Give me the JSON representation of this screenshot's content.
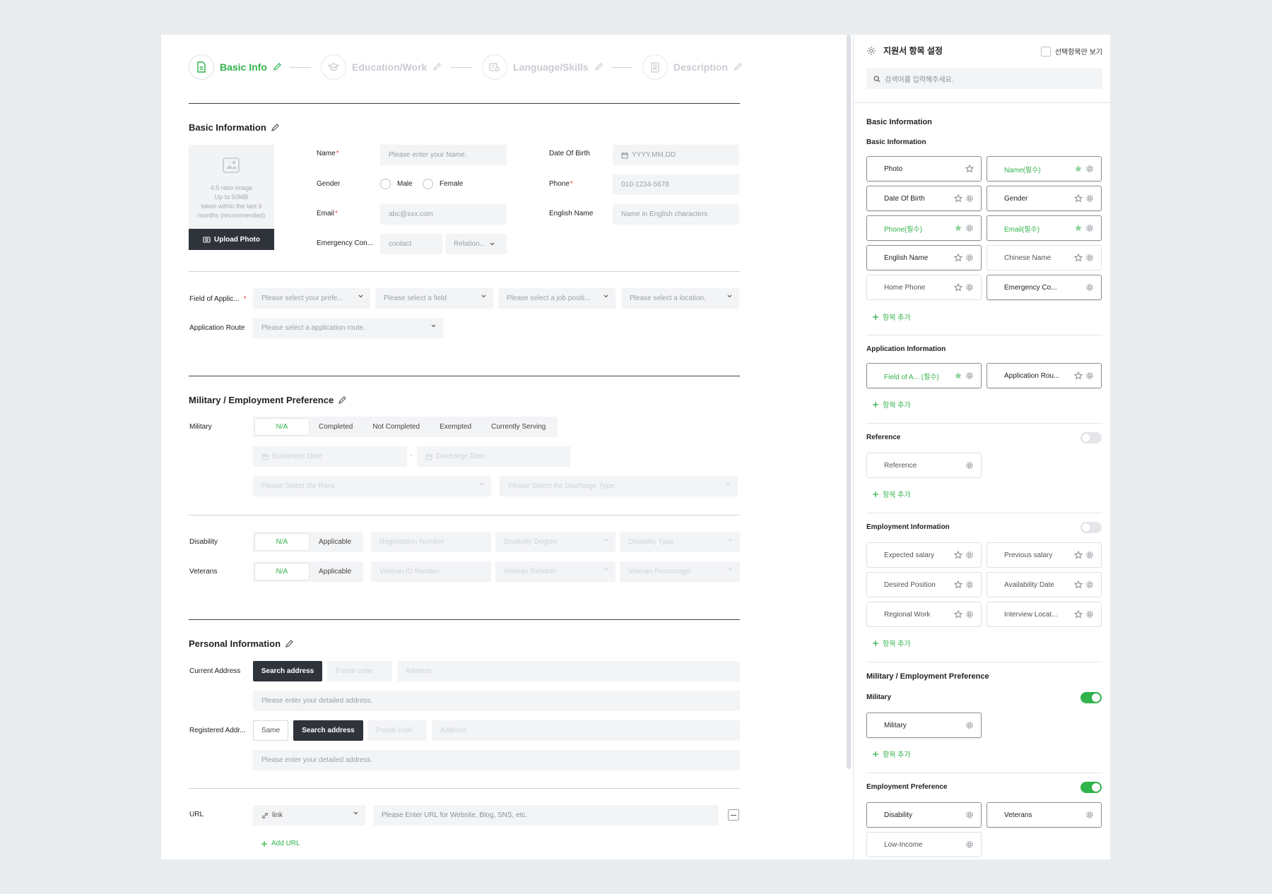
{
  "stepper": {
    "steps": [
      {
        "label": "Basic Info",
        "active": true,
        "icon": "document-icon"
      },
      {
        "label": "Education/Work",
        "active": false,
        "icon": "graduation-cap-icon"
      },
      {
        "label": "Language/Skills",
        "active": false,
        "icon": "skills-icon"
      },
      {
        "label": "Description",
        "active": false,
        "icon": "badge-icon"
      }
    ]
  },
  "basic": {
    "title": "Basic Information",
    "photo_hint": "4:5 ratio image\nUp to 50MB\ntaken within the last 6\nmonths (recommended)",
    "upload_label": "Upload Photo",
    "name_label": "Name",
    "name_placeholder": "Please enter your Name.",
    "gender_label": "Gender",
    "male": "Male",
    "female": "Female",
    "email_label": "Email",
    "email_placeholder": "abc@xxx.com",
    "emergency_label": "Emergency Con...",
    "contact_placeholder": "contact",
    "relation_placeholder": "Relation...",
    "dob_label": "Date Of Birth",
    "dob_placeholder": "YYYY.MM.DD",
    "phone_label": "Phone",
    "phone_placeholder": "010-1234-5678",
    "english_label": "English Name",
    "english_placeholder": "Name in English characters"
  },
  "application": {
    "field_label": "Field of Applic...",
    "pref_placeholder": "Please select your prefe...",
    "field_placeholder": "Please select a field",
    "job_placeholder": "Please select a job positi...",
    "location_placeholder": "Please select a location.",
    "route_label": "Application Route",
    "route_placeholder": "Please select a application route."
  },
  "military": {
    "title": "Military / Employment Preference",
    "label": "Military",
    "options": [
      "N/A",
      "Completed",
      "Not Completed",
      "Exempted",
      "Currently Serving"
    ],
    "enlist_placeholder": "Enlistment Date",
    "discharge_placeholder": "Discharge Date",
    "dash": "-",
    "rank_placeholder": "Please Select the Rank.",
    "discharge_type_placeholder": "Please Select the Discharge Type.",
    "disability_label": "Disability",
    "veterans_label": "Veterans",
    "na": "N/A",
    "applicable": "Applicable",
    "reg_number": "Registration Number",
    "dis_degree": "Disability Degree",
    "dis_type": "Disability Type",
    "vet_id": "Veteran ID Number",
    "vet_relation": "Veteran Relation",
    "vet_percent": "Veteran Percentage"
  },
  "personal": {
    "title": "Personal Information",
    "current_label": "Current Address",
    "search_address": "Search address",
    "postal": "Postal code",
    "address": "Address",
    "detail_placeholder": "Please enter your detailed address.",
    "registered_label": "Registered Addr...",
    "same": "Same",
    "url_label": "URL",
    "link_select": "link",
    "url_placeholder": "Please Enter URL for Website, Blog, SNS, etc.",
    "add_url": "Add URL"
  },
  "sidebar": {
    "title": "지원서 항목 설정",
    "checkbox_label": "선택항목만 보기",
    "search_placeholder": "검색어를 입력해주세요.",
    "add_item": "항목 추가",
    "basic_group": "Basic Information",
    "basic_sub": "Basic Information",
    "basic_chips": [
      {
        "label": "Photo",
        "style": "strong",
        "star": true,
        "gear": false
      },
      {
        "label": "Name(필수)",
        "style": "green",
        "star": true,
        "gear": true
      },
      {
        "label": "Date Of Birth",
        "style": "strong",
        "star": true,
        "gear": true
      },
      {
        "label": "Gender",
        "style": "strong",
        "star": true,
        "gear": true
      },
      {
        "label": "Phone(필수)",
        "style": "green",
        "star": true,
        "gear": true
      },
      {
        "label": "Email(필수)",
        "style": "green",
        "star": true,
        "gear": true
      },
      {
        "label": "English Name",
        "style": "strong",
        "star": true,
        "gear": true
      },
      {
        "label": "Chinese Name",
        "style": "normal",
        "star": true,
        "gear": true
      },
      {
        "label": "Home Phone",
        "style": "normal",
        "star": true,
        "gear": true
      },
      {
        "label": "Emergency Co...",
        "style": "strong",
        "star": false,
        "gear": true
      }
    ],
    "app_sub": "Application Information",
    "app_chips": [
      {
        "label": "Field of A... (필수)",
        "style": "green",
        "star": true,
        "gear": true
      },
      {
        "label": "Application Rou...",
        "style": "strong",
        "star": true,
        "gear": true
      }
    ],
    "reference_sub": "Reference",
    "reference_chip": "Reference",
    "employment_sub": "Employment Information",
    "employment_chips": [
      {
        "label": "Expected salary"
      },
      {
        "label": "Previous salary"
      },
      {
        "label": "Desired Position"
      },
      {
        "label": "Availability Date"
      },
      {
        "label": "Regional Work"
      },
      {
        "label": "Interview Locat..."
      }
    ],
    "military_group": "Military / Employment Preference",
    "military_sub": "Military",
    "military_chip": "Military",
    "emp_pref_sub": "Employment Preference",
    "disability_chip": "Disability",
    "veterans_chip": "Veterans",
    "low_income_chip": "Low-Income"
  },
  "colors": {
    "accent": "#31b34b",
    "dark": "#2f343b",
    "required": "#e53935"
  }
}
